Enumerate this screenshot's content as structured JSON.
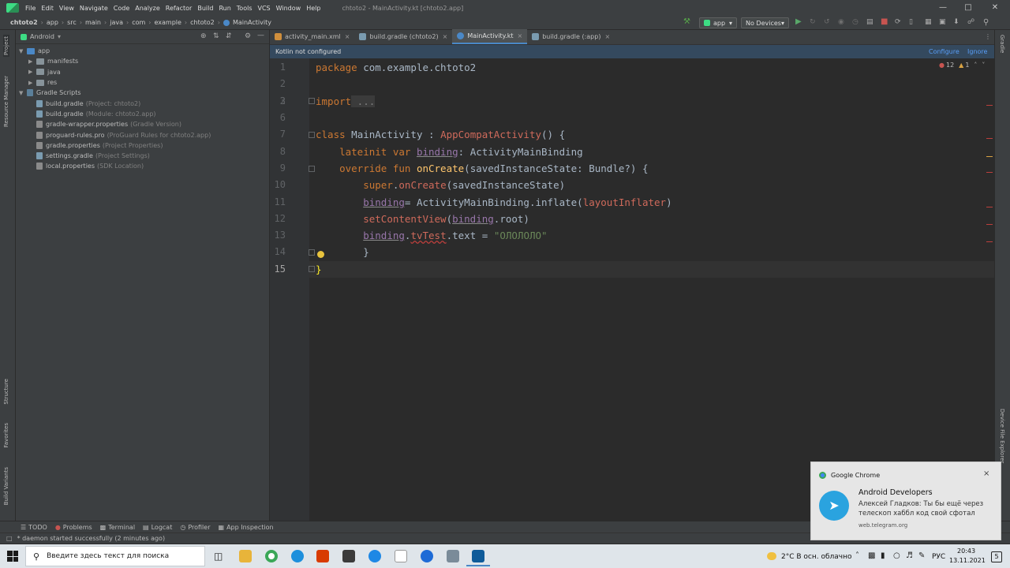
{
  "menu": {
    "items": [
      "File",
      "Edit",
      "View",
      "Navigate",
      "Code",
      "Analyze",
      "Refactor",
      "Build",
      "Run",
      "Tools",
      "VCS",
      "Window",
      "Help"
    ],
    "window_title": "chtoto2 - MainActivity.kt [chtoto2.app]"
  },
  "breadcrumb": [
    "chtoto2",
    "app",
    "src",
    "main",
    "java",
    "com",
    "example",
    "chtoto2",
    "MainActivity"
  ],
  "toolbar": {
    "run_config": "app",
    "device": "No Devices"
  },
  "project_panel": {
    "view": "Android",
    "tree": [
      {
        "label": "app",
        "hint": "",
        "level": 0
      },
      {
        "label": "manifests",
        "hint": "",
        "level": 1
      },
      {
        "label": "java",
        "hint": "",
        "level": 1
      },
      {
        "label": "res",
        "hint": "",
        "level": 1
      },
      {
        "label": "Gradle Scripts",
        "hint": "",
        "level": 0
      },
      {
        "label": "build.gradle",
        "hint": "(Project: chtoto2)",
        "level": 1
      },
      {
        "label": "build.gradle",
        "hint": "(Module: chtoto2.app)",
        "level": 1
      },
      {
        "label": "gradle-wrapper.properties",
        "hint": "(Gradle Version)",
        "level": 1
      },
      {
        "label": "proguard-rules.pro",
        "hint": "(ProGuard Rules for chtoto2.app)",
        "level": 1
      },
      {
        "label": "gradle.properties",
        "hint": "(Project Properties)",
        "level": 1
      },
      {
        "label": "settings.gradle",
        "hint": "(Project Settings)",
        "level": 1
      },
      {
        "label": "local.properties",
        "hint": "(SDK Location)",
        "level": 1
      }
    ]
  },
  "left_stripe": [
    "Project",
    "Resource Manager",
    "Structure",
    "Favorites",
    "Build Variants"
  ],
  "right_stripe": [
    "Gradle",
    "Device File Explorer"
  ],
  "tabs": [
    {
      "label": "activity_main.xml",
      "active": false
    },
    {
      "label": "build.gradle (chtoto2)",
      "active": false
    },
    {
      "label": "MainActivity.kt",
      "active": true
    },
    {
      "label": "build.gradle (:app)",
      "active": false
    }
  ],
  "banner": {
    "text": "Kotlin not configured",
    "configure": "Configure",
    "ignore": "Ignore"
  },
  "inspections": {
    "errors": "12",
    "warnings": "1"
  },
  "code": {
    "line_numbers": [
      "1",
      "2",
      "3",
      "6",
      "7",
      "8",
      "9",
      "10",
      "11",
      "12",
      "13",
      "14",
      "15"
    ],
    "l1_kw": "package",
    "l1_rest": " com.example.chtoto2",
    "l3_kw": "import",
    "l3_rest": " ...",
    "l7_kw": "class",
    "l7_a": " MainActivity : ",
    "l7_err": "AppCompatActivity",
    "l7_b": "() {",
    "l8_kw": "lateinit var ",
    "l8_name": "binding",
    "l8_rest": ": ActivityMainBinding",
    "l9_kw": "override fun ",
    "l9_fn": "onCreate",
    "l9_rest": "(savedInstanceState: Bundle?) {",
    "l10_kw": "super",
    "l10_a": ".",
    "l10_fn": "onCreate",
    "l10_rest": "(savedInstanceState)",
    "l11_name": "binding",
    "l11_a": "= ActivityMainBinding.",
    "l11_fn": "inflate",
    "l11_b": "(",
    "l11_err": "layoutInflater",
    "l11_c": ")",
    "l12_fn": "setContentView",
    "l12_a": "(",
    "l12_name": "binding",
    "l12_b": ".root)",
    "l13_name": "binding",
    "l13_a": ".",
    "l13_err": "tvTest",
    "l13_b": ".text = ",
    "l13_str": "\"ОЛОЛОЛО\"",
    "l14": "}",
    "l15": "}"
  },
  "bottom_tabs": [
    "TODO",
    "Problems",
    "Terminal",
    "Logcat",
    "Profiler",
    "App Inspection"
  ],
  "status_text": "* daemon started successfully (2 minutes ago)",
  "taskbar": {
    "search_placeholder": "Введите здесь текст для поиска",
    "weather": "2°C  В осн. облачно",
    "lang": "РУС",
    "time": "20:43",
    "date": "13.11.2021",
    "notif_count": "5"
  },
  "toast": {
    "app": "Google Chrome",
    "title": "Android Developers",
    "body": "Алексей Гладков: Ты бы ещё через телескоп хаббл код свой сфотал",
    "source": "web.telegram.org"
  }
}
